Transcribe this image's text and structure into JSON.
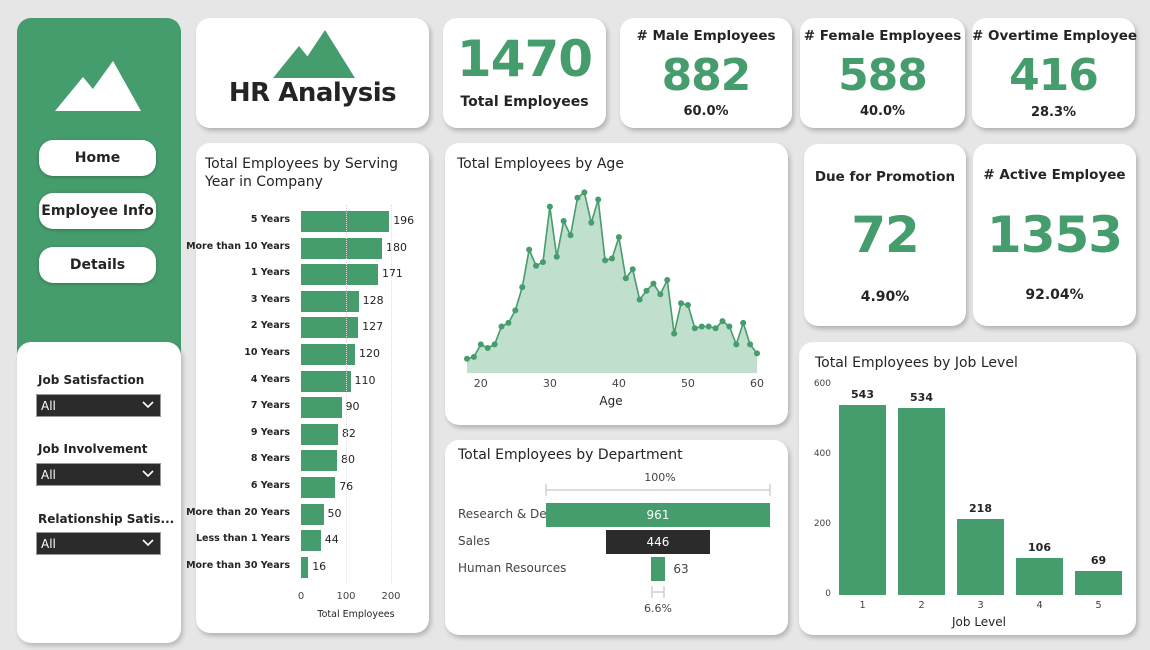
{
  "sidebar": {
    "logo_icon": "mountain-icon",
    "nav": [
      {
        "label": "Home"
      },
      {
        "label": "Employee Info"
      },
      {
        "label": "Details"
      }
    ]
  },
  "filters": [
    {
      "label": "Job Satisfaction",
      "value": "All"
    },
    {
      "label": "Job Involvement",
      "value": "All"
    },
    {
      "label": "Relationship Satis...",
      "value": "All"
    }
  ],
  "header": {
    "title": "HR Analysis",
    "logo_icon": "mountain-icon"
  },
  "kpis": {
    "total": {
      "value": "1470",
      "label": "Total Employees"
    },
    "male": {
      "title": "# Male Employees",
      "value": "882",
      "pct": "60.0%"
    },
    "female": {
      "title": "# Female Employees",
      "value": "588",
      "pct": "40.0%"
    },
    "overtime": {
      "title": "# Overtime Employee",
      "value": "416",
      "pct": "28.3%"
    },
    "promotion": {
      "title": "Due for Promotion",
      "value": "72",
      "pct": "4.90%"
    },
    "active": {
      "title": "# Active Employee",
      "value": "1353",
      "pct": "92.04%"
    }
  },
  "colors": {
    "accent": "#459c6c",
    "dark": "#2b2b2b"
  },
  "chart_data": [
    {
      "type": "bar",
      "orientation": "horizontal",
      "title": "Total Employees by Serving Year in Company",
      "xlabel": "Total Employees",
      "categories": [
        "5 Years",
        "More than 10 Years",
        "1 Years",
        "3 Years",
        "2 Years",
        "10 Years",
        "4 Years",
        "7 Years",
        "9 Years",
        "8 Years",
        "6 Years",
        "More than 20 Years",
        "Less than 1 Years",
        "More than 30 Years"
      ],
      "values": [
        196,
        180,
        171,
        128,
        127,
        120,
        110,
        90,
        82,
        80,
        76,
        50,
        44,
        16
      ],
      "xticks": [
        "0",
        "100",
        "200"
      ],
      "xlim": [
        0,
        200
      ]
    },
    {
      "type": "area",
      "title": "Total Employees by Age",
      "xlabel": "Age",
      "xticks": [
        "20",
        "30",
        "40",
        "50",
        "60"
      ],
      "x": [
        18,
        19,
        20,
        21,
        22,
        23,
        24,
        25,
        26,
        27,
        28,
        29,
        30,
        31,
        32,
        33,
        34,
        35,
        36,
        37,
        38,
        39,
        40,
        41,
        42,
        43,
        44,
        45,
        46,
        47,
        48,
        49,
        50,
        51,
        52,
        53,
        54,
        55,
        56,
        57,
        58,
        59,
        60
      ],
      "values": [
        8,
        9,
        16,
        14,
        16,
        26,
        28,
        35,
        48,
        69,
        60,
        62,
        93,
        65,
        85,
        77,
        98,
        101,
        84,
        97,
        63,
        64,
        76,
        53,
        58,
        41,
        46,
        50,
        44,
        52,
        22,
        39,
        38,
        25,
        26,
        26,
        25,
        29,
        26,
        16,
        28,
        16,
        11
      ]
    },
    {
      "type": "funnel",
      "title": "Total Employees by Department",
      "categories": [
        "Research & Deve...",
        "Sales",
        "Human Resources"
      ],
      "values": [
        961,
        446,
        63
      ],
      "top_pct": "100%",
      "bottom_pct": "6.6%"
    },
    {
      "type": "bar",
      "title": "Total Employees by Job Level",
      "xlabel": "Job Level",
      "categories": [
        "1",
        "2",
        "3",
        "4",
        "5"
      ],
      "values": [
        543,
        534,
        218,
        106,
        69
      ],
      "yticks": [
        "0",
        "200",
        "400",
        "600"
      ],
      "ylim": [
        0,
        600
      ]
    }
  ]
}
